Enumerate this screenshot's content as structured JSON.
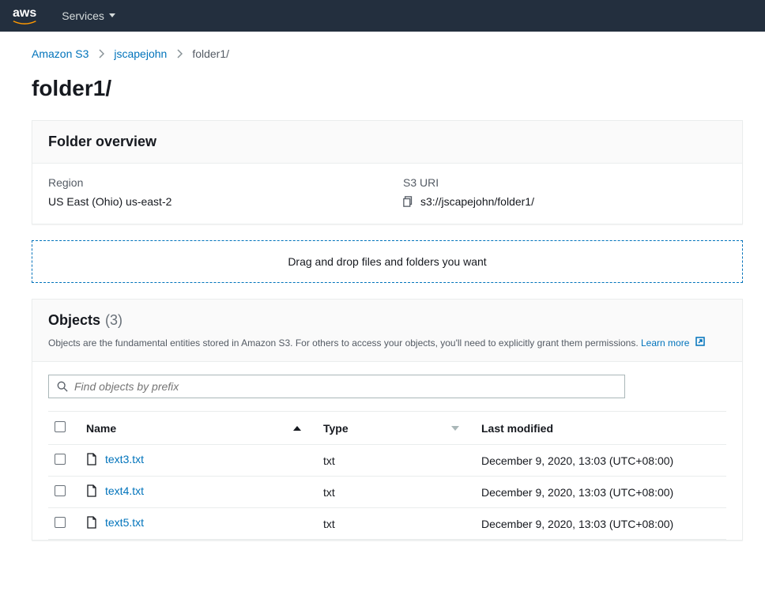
{
  "topbar": {
    "logo": "aws",
    "services_label": "Services"
  },
  "breadcrumb": [
    {
      "label": "Amazon S3",
      "link": true
    },
    {
      "label": "jscapejohn",
      "link": true
    },
    {
      "label": "folder1/",
      "link": false
    }
  ],
  "page_title": "folder1/",
  "overview": {
    "title": "Folder overview",
    "region_label": "Region",
    "region_value": "US East (Ohio) us-east-2",
    "s3uri_label": "S3 URI",
    "s3uri_value": "s3://jscapejohn/folder1/"
  },
  "dropzone": {
    "text": "Drag and drop files and folders you want"
  },
  "objects": {
    "title": "Objects",
    "count": "(3)",
    "description": "Objects are the fundamental entities stored in Amazon S3. For others to access your objects, you'll need to explicitly grant them permissions. ",
    "learn_more": "Learn more",
    "search_placeholder": "Find objects by prefix",
    "columns": {
      "name": "Name",
      "type": "Type",
      "last_modified": "Last modified"
    },
    "rows": [
      {
        "name": "text3.txt",
        "type": "txt",
        "last_modified": "December 9, 2020, 13:03 (UTC+08:00)"
      },
      {
        "name": "text4.txt",
        "type": "txt",
        "last_modified": "December 9, 2020, 13:03 (UTC+08:00)"
      },
      {
        "name": "text5.txt",
        "type": "txt",
        "last_modified": "December 9, 2020, 13:03 (UTC+08:00)"
      }
    ]
  }
}
